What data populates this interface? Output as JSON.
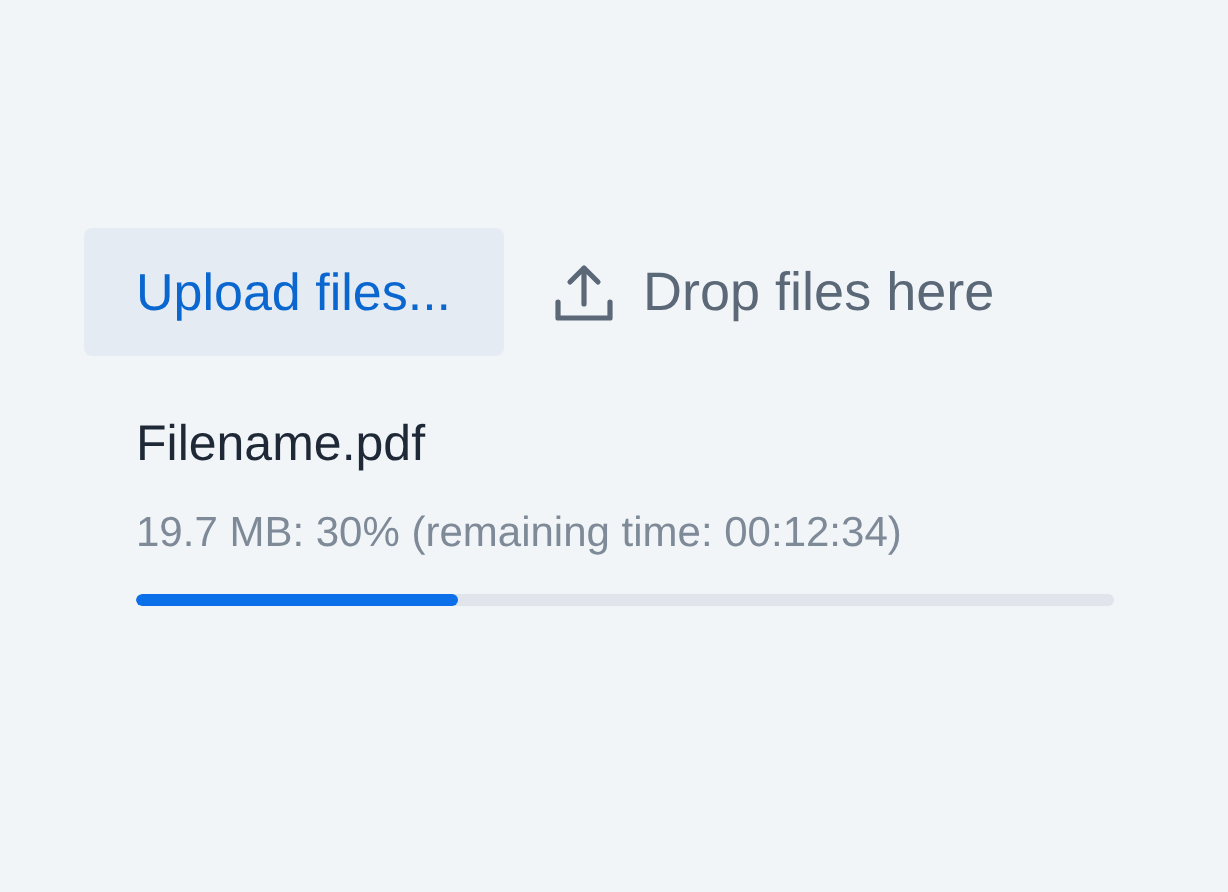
{
  "upload_button": {
    "label": "Upload files..."
  },
  "drop_zone": {
    "label": "Drop files here"
  },
  "file": {
    "name": "Filename.pdf",
    "status": "19.7 MB: 30% (remaining time: 00:12:34)",
    "level": 0.33
  }
}
